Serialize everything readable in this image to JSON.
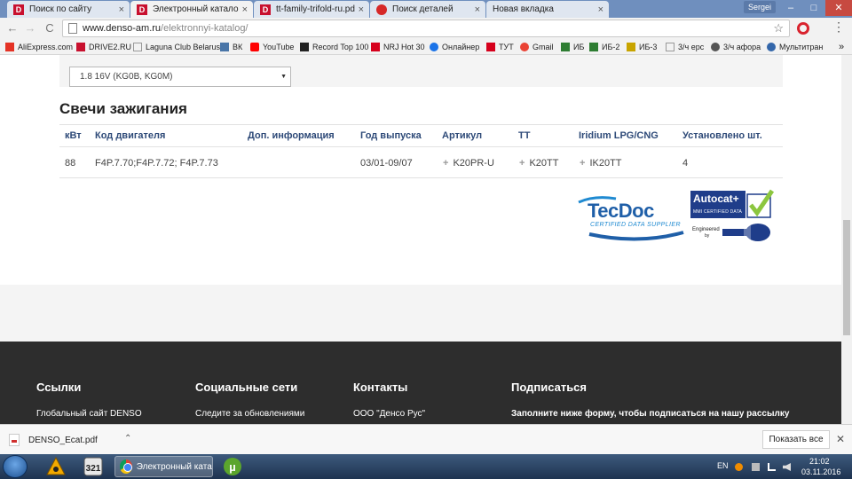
{
  "browser": {
    "tabs": [
      {
        "title": "Поиск по сайту",
        "icon": "denso-d-icon"
      },
      {
        "title": "Электронный каталог, п",
        "icon": "denso-d-icon",
        "active": true
      },
      {
        "title": "tt-family-trifold-ru.pdf",
        "icon": "pdf-icon"
      },
      {
        "title": "Поиск деталей",
        "icon": "red-circle-icon"
      },
      {
        "title": "Новая вкладка",
        "icon": "none"
      }
    ],
    "tab_close_glyph": "×",
    "profile_name": "Sergei",
    "window_controls": {
      "minimize": "–",
      "maximize": "□",
      "close": "✕"
    },
    "nav": {
      "back": "←",
      "forward": "→",
      "reload": "C"
    },
    "url_host": "www.denso-am.ru",
    "url_path": "/elektronnyi-katalog/",
    "star_glyph": "☆",
    "menu_glyph": "⋮",
    "bookmarks": [
      {
        "label": "AliExpress.com",
        "color": "#e43225"
      },
      {
        "label": "DRIVE2.RU",
        "color": "#c8102e"
      },
      {
        "label": "Laguna Club Belarus",
        "color": "#888888"
      },
      {
        "label": "ВК",
        "color": "#4a76a8"
      },
      {
        "label": "YouTube",
        "color": "#ff0000"
      },
      {
        "label": "Record Top 100",
        "color": "#222222"
      },
      {
        "label": "NRJ Hot 30",
        "color": "#d6001c"
      },
      {
        "label": "Онлайнер",
        "color": "#1a73e8"
      },
      {
        "label": "ТУТ",
        "color": "#d6001c"
      },
      {
        "label": "Gmail",
        "color": "#ea4335"
      },
      {
        "label": "ИБ",
        "color": "#2e7d32"
      },
      {
        "label": "ИБ-2",
        "color": "#2e7d32"
      },
      {
        "label": "ИБ-3",
        "color": "#c8a400"
      },
      {
        "label": "3/ч ерс",
        "color": "#888888"
      },
      {
        "label": "3/ч афора",
        "color": "#555555"
      },
      {
        "label": "Мультитран",
        "color": "#3366aa"
      }
    ],
    "bookmarks_more": "»"
  },
  "page": {
    "engine_select_value": "1.8 16V (KG0B, KG0M)",
    "section_title": "Свечи зажигания",
    "table": {
      "headers": [
        "кВт",
        "Код двигателя",
        "Доп. информация",
        "Год выпуска",
        "Артикул",
        "TT",
        "Iridium LPG/CNG",
        "Установлено шт."
      ],
      "row": {
        "kw": "88",
        "engine_code": "F4P.7.70;F4P.7.72; F4P.7.73",
        "extra": "",
        "years": "03/01-09/07",
        "article": "K20PR-U",
        "tt": "K20TT",
        "iridium": "IK20TT",
        "installed": "4"
      }
    },
    "logos": {
      "tecdoc_word": "TecDoc",
      "tecdoc_sub": "CERTIFIED DATA SUPPLIER",
      "autocat_word": "Autocat+",
      "autocat_sub": "MMI CERTIFIED DATA",
      "autocat_engineered": "Engineered",
      "autocat_by": "by"
    },
    "footer": {
      "columns": [
        {
          "heading": "Ссылки",
          "text": "Глобальный сайт DENSO"
        },
        {
          "heading": "Социальные сети",
          "text": "Следите за обновлениями"
        },
        {
          "heading": "Контакты",
          "text": "ООО \"Денсо Рус\""
        },
        {
          "heading": "Подписаться",
          "text": "Заполните ниже форму, чтобы подписаться на нашу рассылку"
        }
      ]
    }
  },
  "download_shelf": {
    "file_name": "DENSO_Ecat.pdf",
    "chevron": "⌃",
    "show_all_label": "Показать все",
    "close": "✕"
  },
  "taskbar": {
    "chrome_label": "Электронный катал...",
    "lang": "EN",
    "time": "21:02",
    "date": "03.11.2016"
  }
}
